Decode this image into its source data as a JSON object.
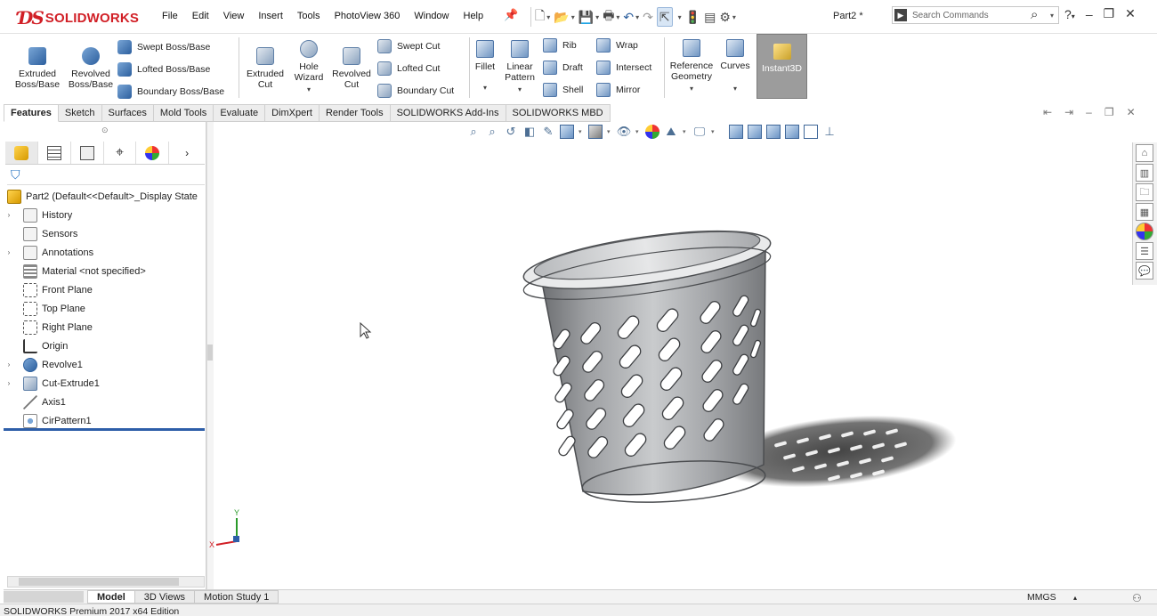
{
  "app": {
    "brand": "SOLIDWORKS",
    "document_title": "Part2 *"
  },
  "menu": [
    "File",
    "Edit",
    "View",
    "Insert",
    "Tools",
    "PhotoView 360",
    "Window",
    "Help"
  ],
  "search": {
    "placeholder": "Search Commands"
  },
  "ribbon": {
    "extruded_boss": "Extruded Boss/Base",
    "revolved_boss": "Revolved Boss/Base",
    "swept_boss": "Swept Boss/Base",
    "lofted_boss": "Lofted Boss/Base",
    "boundary_boss": "Boundary Boss/Base",
    "extruded_cut": "Extruded Cut",
    "hole_wizard": "Hole Wizard",
    "revolved_cut": "Revolved Cut",
    "swept_cut": "Swept Cut",
    "lofted_cut": "Lofted Cut",
    "boundary_cut": "Boundary Cut",
    "fillet": "Fillet",
    "linear_pattern": "Linear Pattern",
    "rib": "Rib",
    "draft": "Draft",
    "shell": "Shell",
    "wrap": "Wrap",
    "intersect": "Intersect",
    "mirror": "Mirror",
    "reference_geometry": "Reference Geometry",
    "curves": "Curves",
    "instant3d": "Instant3D"
  },
  "command_tabs": [
    "Features",
    "Sketch",
    "Surfaces",
    "Mold Tools",
    "Evaluate",
    "DimXpert",
    "Render Tools",
    "SOLIDWORKS Add-Ins",
    "SOLIDWORKS MBD"
  ],
  "feature_tree": {
    "root": "Part2  (Default<<Default>_Display State",
    "items": [
      "History",
      "Sensors",
      "Annotations",
      "Material <not specified>",
      "Front Plane",
      "Top Plane",
      "Right Plane",
      "Origin",
      "Revolve1",
      "Cut-Extrude1",
      "Axis1",
      "CirPattern1"
    ]
  },
  "triad": {
    "x": "X",
    "y": "Y"
  },
  "bottom_tabs": [
    "Model",
    "3D Views",
    "Motion Study 1"
  ],
  "status": {
    "edition": "SOLIDWORKS Premium 2017 x64 Edition",
    "units": "MMGS"
  },
  "colors": {
    "brand_red": "#d11f26",
    "accent_blue": "#2d5ea8",
    "instant3d_bg": "#9c9c9c"
  }
}
